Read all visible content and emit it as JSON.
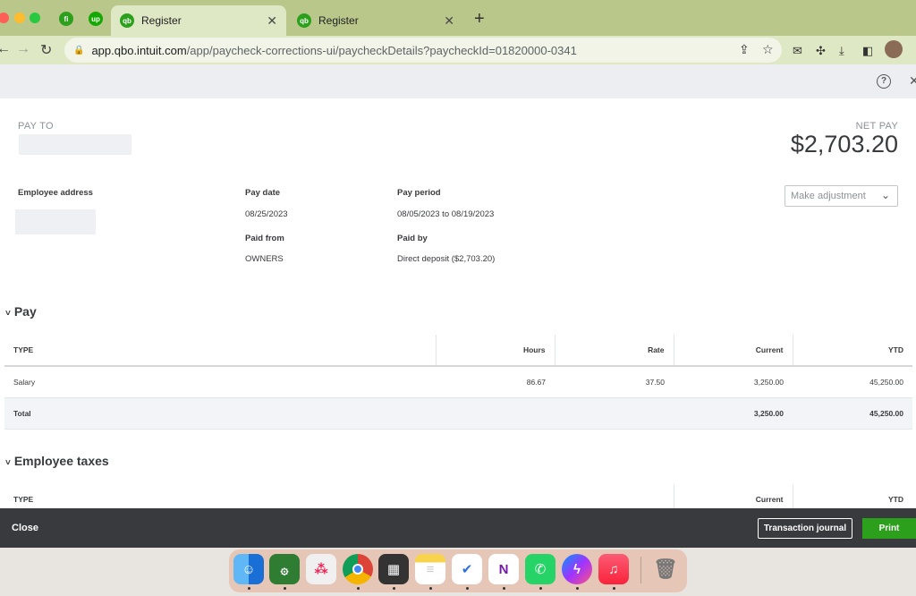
{
  "browser": {
    "tabs": [
      {
        "title": "Register",
        "active": true
      },
      {
        "title": "Register",
        "active": false
      }
    ],
    "url_host": "app.qbo.intuit.com",
    "url_path": "/app/paycheck-corrections-ui/paycheckDetails?paycheckId=01820000-0341"
  },
  "paycheck": {
    "pay_to_label": "PAY TO",
    "net_pay_label": "NET PAY",
    "net_pay": "$2,703.20",
    "employee_address_label": "Employee address",
    "pay_date_label": "Pay date",
    "pay_date": "08/25/2023",
    "pay_period_label": "Pay period",
    "pay_period": "08/05/2023 to 08/19/2023",
    "paid_from_label": "Paid from",
    "paid_from": "OWNERS",
    "paid_by_label": "Paid by",
    "paid_by": "Direct deposit ($2,703.20)",
    "adjustment_placeholder": "Make adjustment"
  },
  "pay_section": {
    "title": "Pay",
    "columns": [
      "TYPE",
      "Hours",
      "Rate",
      "Current",
      "YTD"
    ],
    "rows": [
      {
        "type": "Salary",
        "hours": "86.67",
        "rate": "37.50",
        "current": "3,250.00",
        "ytd": "45,250.00"
      }
    ],
    "total": {
      "label": "Total",
      "current": "3,250.00",
      "ytd": "45,250.00"
    }
  },
  "taxes_section": {
    "title": "Employee taxes",
    "columns": [
      "TYPE",
      "Current",
      "YTD"
    ]
  },
  "footer": {
    "close_label": "Close",
    "journal_label": "Transaction journal",
    "print_label": "Print"
  },
  "colors": {
    "brand_green": "#2ca01c",
    "footer_bg": "#393a3d",
    "tabstrip": "#b9c78a"
  },
  "dock": {
    "apps": [
      "finder-icon",
      "quran-icon",
      "launchpad-icon",
      "chrome-icon",
      "calculator-icon",
      "notes-icon",
      "tasks-icon",
      "onenote-icon",
      "whatsapp-icon",
      "messenger-icon",
      "music-icon",
      "trash-icon"
    ]
  }
}
